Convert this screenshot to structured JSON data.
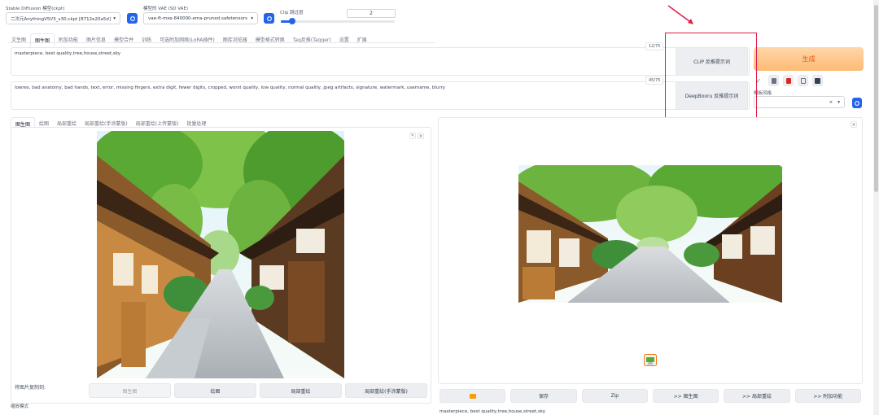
{
  "header": {
    "ckpt_label": "Stable Diffusion 模型(ckpt)",
    "ckpt_value": "二次元AnythingV5V3_v30.ckpt [8712e20a5d]",
    "vae_label": "模型的 VAE (SD VAE)",
    "vae_value": "vae-ft-mse-840000-ema-pruned.safetensors",
    "clip_label": "Clip 跳过层",
    "clip_value": "2",
    "clip_fraction": 0.1
  },
  "main_tabs": [
    "文生图",
    "图生图",
    "附加功能",
    "图片信息",
    "模型合并",
    "训练",
    "可选附加网络(LoRA插件)",
    "图库浏览器",
    "模型格式转换",
    "Tag反推(Tagger)",
    "设置",
    "扩展"
  ],
  "main_tab_active": 1,
  "positive_prompt": {
    "text": "masterpiece, best quality,tree,house,street,sky",
    "counter": "12/75"
  },
  "negative_prompt": {
    "text": "lowres, bad anatomy, bad hands, text, error, missing fingers, extra digit, fewer digits, cropped, worst quality, low quality, normal quality, jpeg artifacts, signature, watermark, username, blurry",
    "counter": "45/75"
  },
  "interrogate": {
    "clip_label": "CLIP 反推提示词",
    "deepbooru_label": "DeepBooru 反推提示词"
  },
  "generate_label": "生成",
  "style_label": "模板风格",
  "style_clear": "×",
  "style_arrow": "▾",
  "sub_tabs": [
    "图生图",
    "绘图",
    "局部重绘",
    "局部重绘(手涂蒙版)",
    "局部重绘(上传蒙版)",
    "批量处理"
  ],
  "sub_tab_active": 0,
  "copy_label": "将图片复制到:",
  "copy_buttons": [
    "图生图",
    "绘图",
    "局部重绘",
    "局部重绘(手涂蒙版)"
  ],
  "output_buttons": [
    "保存",
    "Zip",
    ">> 图生图",
    ">> 局部重绘",
    ">> 附加功能"
  ],
  "output_caption": "masterpiece, best quality,tree,house,street,sky",
  "resize_label": "缩放模式",
  "close_glyph": "×",
  "pencil_glyph": "✎",
  "colors": {
    "accent": "#2563eb",
    "generate": "#fdba74",
    "highlight": "#e11d48"
  }
}
